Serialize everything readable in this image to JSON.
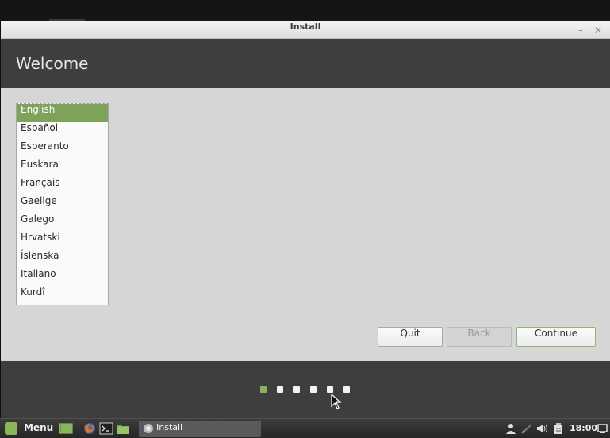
{
  "window": {
    "title": "Install",
    "minimize_glyph": "–",
    "close_glyph": "✕"
  },
  "header": {
    "title": "Welcome"
  },
  "languages": {
    "selected_index": 0,
    "items": [
      "English",
      "Español",
      "Esperanto",
      "Euskara",
      "Français",
      "Gaeilge",
      "Galego",
      "Hrvatski",
      "Íslenska",
      "Italiano",
      "Kurdî"
    ]
  },
  "buttons": {
    "quit": "Quit",
    "back": "Back",
    "continue": "Continue"
  },
  "progress": {
    "total_steps": 6,
    "current_step": 1
  },
  "taskbar": {
    "menu_label": "Menu",
    "task_label": "Install",
    "clock": "18:00",
    "launchers": [
      "show-desktop-icon",
      "firefox-icon",
      "terminal-icon",
      "files-icon"
    ],
    "tray": [
      "user-icon",
      "network-icon",
      "volume-icon",
      "clipboard-icon",
      "window-list-icon"
    ]
  },
  "colors": {
    "accent": "#8bb35e",
    "selected_row": "#7ea25a",
    "header_bg": "#3e3e3e",
    "content_bg": "#d6d6d6"
  }
}
